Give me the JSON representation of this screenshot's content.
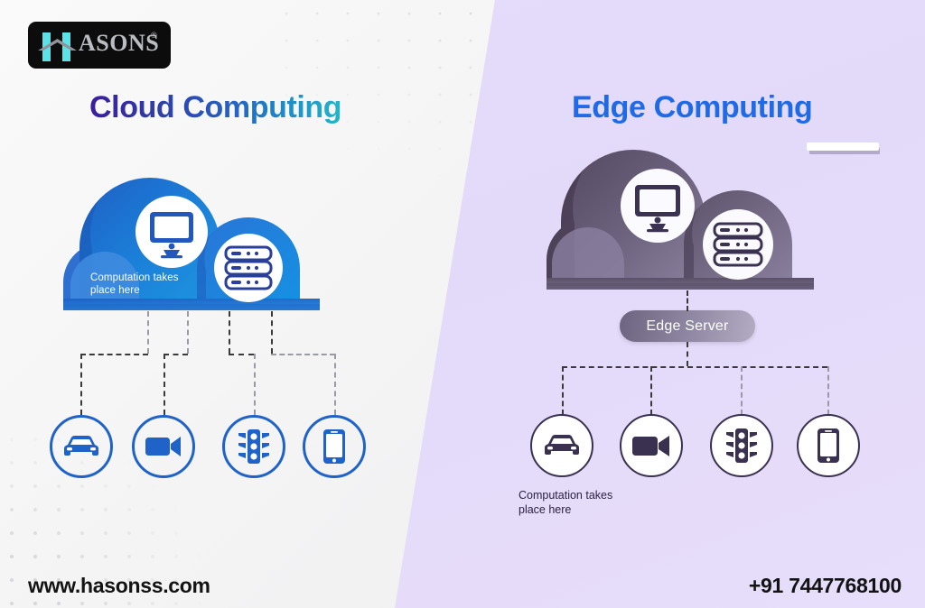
{
  "brand": {
    "logo_text": "ASONS",
    "logo_registered": "®",
    "logo_icon": "hasons-h-logo"
  },
  "left_panel": {
    "title": "Cloud Computing",
    "title_gradient_from": "#3b1d9e",
    "title_gradient_to": "#25b5c9",
    "cloud_color": "#1277d4",
    "cloud_caption": "Computation takes\nplace here",
    "cloud_icons": [
      {
        "name": "monitor-icon",
        "label": "Monitor"
      },
      {
        "name": "server-icon",
        "label": "Server"
      }
    ],
    "nodes": [
      {
        "name": "car-icon",
        "label": "Car"
      },
      {
        "name": "video-camera-icon",
        "label": "Video Camera"
      },
      {
        "name": "traffic-light-icon",
        "label": "Traffic Light"
      },
      {
        "name": "smartphone-icon",
        "label": "Smartphone"
      }
    ],
    "node_color": "#1f63c8"
  },
  "right_panel": {
    "title": "Edge Computing",
    "title_color": "#1f6ae8",
    "background_color": "#e4daf9",
    "cloud_color": "#6b617f",
    "edge_server_label": "Edge Server",
    "cloud_icons": [
      {
        "name": "monitor-icon",
        "label": "Monitor"
      },
      {
        "name": "server-icon",
        "label": "Server"
      }
    ],
    "nodes": [
      {
        "name": "car-icon",
        "label": "Car"
      },
      {
        "name": "video-camera-icon",
        "label": "Video Camera"
      },
      {
        "name": "traffic-light-icon",
        "label": "Traffic Light"
      },
      {
        "name": "smartphone-icon",
        "label": "Smartphone"
      }
    ],
    "node_color": "#3a3050",
    "caption": "Computation takes\nplace here"
  },
  "footer": {
    "website": "www.hasonss.com",
    "phone": "+91 7447768100"
  }
}
